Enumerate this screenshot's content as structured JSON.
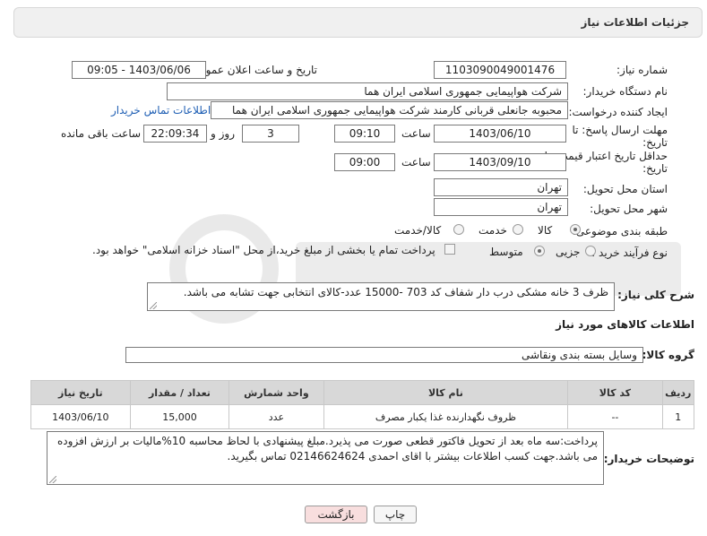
{
  "header": {
    "title": "جزئیات اطلاعات نیاز"
  },
  "need_number": {
    "label": "شماره نیاز:",
    "value": "1103090049001476"
  },
  "announce": {
    "label": "تاریخ و ساعت اعلان عمومی:",
    "value": "1403/06/06 - 09:05"
  },
  "buyer_org": {
    "label": "نام دستگاه خریدار:",
    "value": "شرکت هواپیمایی جمهوری اسلامی ایران هما"
  },
  "creator": {
    "label": "ایجاد کننده درخواست:",
    "value": "محبوبه جانعلی قربانی کارمند شرکت هواپیمایی جمهوری اسلامی ایران هما",
    "contact_link": "اطلاعات تماس خریدار"
  },
  "deadline": {
    "label_line1": "مهلت ارسال پاسخ: تا",
    "label_line2": "تاریخ:",
    "date": "1403/06/10",
    "time_label": "ساعت",
    "time": "09:10",
    "days": "3",
    "days_label": "روز و",
    "remaining": "22:09:34",
    "remaining_label": "ساعت باقی مانده"
  },
  "validity": {
    "label_line1": "حداقل تاریخ اعتبار قیمت: تا",
    "label_line2": "تاریخ:",
    "date": "1403/09/10",
    "time_label": "ساعت",
    "time": "09:00"
  },
  "province": {
    "label": "استان محل تحویل:",
    "value": "تهران"
  },
  "city": {
    "label": "شهر محل تحویل:",
    "value": "تهران"
  },
  "category": {
    "label": "طبقه بندی موضوعی:",
    "options": [
      "کالا",
      "خدمت",
      "کالا/خدمت"
    ],
    "selected": "کالا"
  },
  "process": {
    "label": "نوع فرآیند خرید :",
    "options": [
      "جزیی",
      "متوسط"
    ],
    "selected": "متوسط",
    "note": "پرداخت تمام یا بخشی از مبلغ خرید،از محل \"اسناد خزانه اسلامی\" خواهد بود."
  },
  "description": {
    "label": "شرح کلی نیاز:",
    "value": "ظرف 3 خانه مشکی درب دار شفاف کد 703 -15000 عدد-کالای انتخابی جهت تشابه می باشد."
  },
  "goods_info": {
    "title": "اطلاعات کالاهای مورد نیاز"
  },
  "goods_group": {
    "label": "گروه کالا:",
    "value": "وسایل بسته بندی  ونقاشی"
  },
  "table": {
    "headers": [
      "ردیف",
      "کد کالا",
      "نام کالا",
      "واحد شمارش",
      "تعداد / مقدار",
      "تاریخ نیاز"
    ],
    "rows": [
      [
        "1",
        "--",
        "ظروف نگهدارنده غذا یکبار مصرف",
        "عدد",
        "15,000",
        "1403/06/10"
      ]
    ]
  },
  "buyer_notes": {
    "label": "توضیحات خریدار:",
    "value": "پرداخت:سه ماه بعد از تحویل فاکتور قطعی صورت می پذیرد.مبلغ پیشنهادی با لحاظ محاسبه 10%مالیات بر ارزش افزوده می باشد.جهت کسب اطلاعات بیشتر با اقای احمدی 02146624624 تماس بگیرید."
  },
  "buttons": {
    "print": "چاپ",
    "back": "بازگشت"
  },
  "colors": {
    "back_button_bg": "#f8dede",
    "link": "#1f5fb4",
    "header_bg": "#f0f0f0"
  }
}
